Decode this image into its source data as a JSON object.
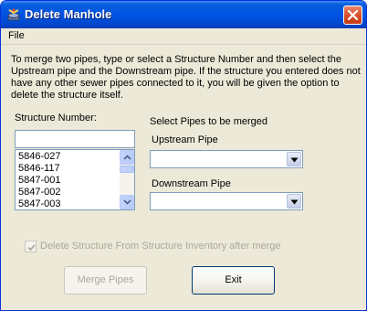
{
  "window": {
    "title": "Delete Manhole"
  },
  "menu": {
    "items": [
      "File"
    ]
  },
  "description": "To merge two pipes, type or select a Structure Number and then select the Upstream pipe and the Downstream pipe. If the structure you entered does not have any other sewer pipes connected to it, you will be given the option to delete the structure itself.",
  "structure": {
    "label": "Structure Number:",
    "value": "",
    "list": [
      "5846-027",
      "5846-117",
      "5847-001",
      "5847-002",
      "5847-003"
    ]
  },
  "pipes": {
    "section_label": "Select Pipes to be merged",
    "upstream_label": "Upstream Pipe",
    "upstream_value": "",
    "downstream_label": "Downstream Pipe",
    "downstream_value": ""
  },
  "checkbox": {
    "label": "Delete Structure From Structure Inventory after merge",
    "checked": true,
    "enabled": false
  },
  "buttons": {
    "merge_label": "Merge Pipes",
    "merge_enabled": false,
    "exit_label": "Exit"
  },
  "colors": {
    "titlebar": "#0054e3",
    "window_bg": "#ece9d8",
    "close": "#d9512c",
    "disabled_text": "#aca899"
  }
}
